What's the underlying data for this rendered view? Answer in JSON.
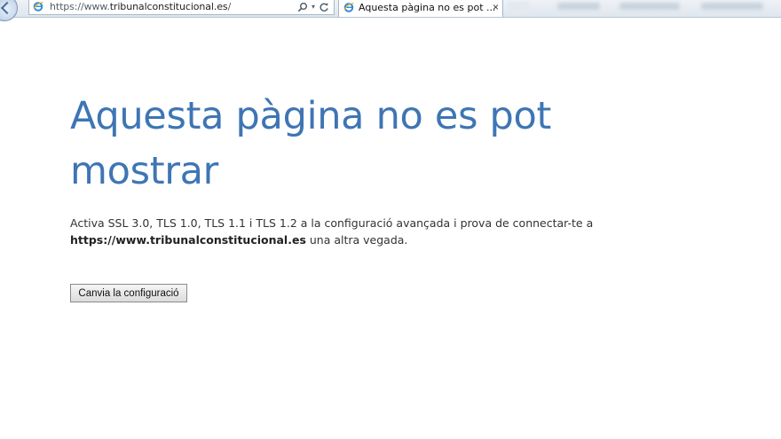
{
  "browser": {
    "url_prefix": "https://www.",
    "url_domain": "tribunalconstitucional.es",
    "url_suffix": "/",
    "tab_title": "Aquesta pàgina no es pot ...",
    "tab_close": "×",
    "search_dropdown": "▾"
  },
  "page": {
    "heading": "Aquesta pàgina no es pot mostrar",
    "message_before": "Activa SSL 3.0, TLS 1.0, TLS 1.1 i TLS 1.2 a la configuració avançada i prova de connectar-te a",
    "message_url": "https://www.tribunalconstitucional.es",
    "message_after": " una altra vegada.",
    "button_label": "Canvia la configuració"
  },
  "colors": {
    "heading": "#3e75b4",
    "accent": "#1e78d6"
  }
}
